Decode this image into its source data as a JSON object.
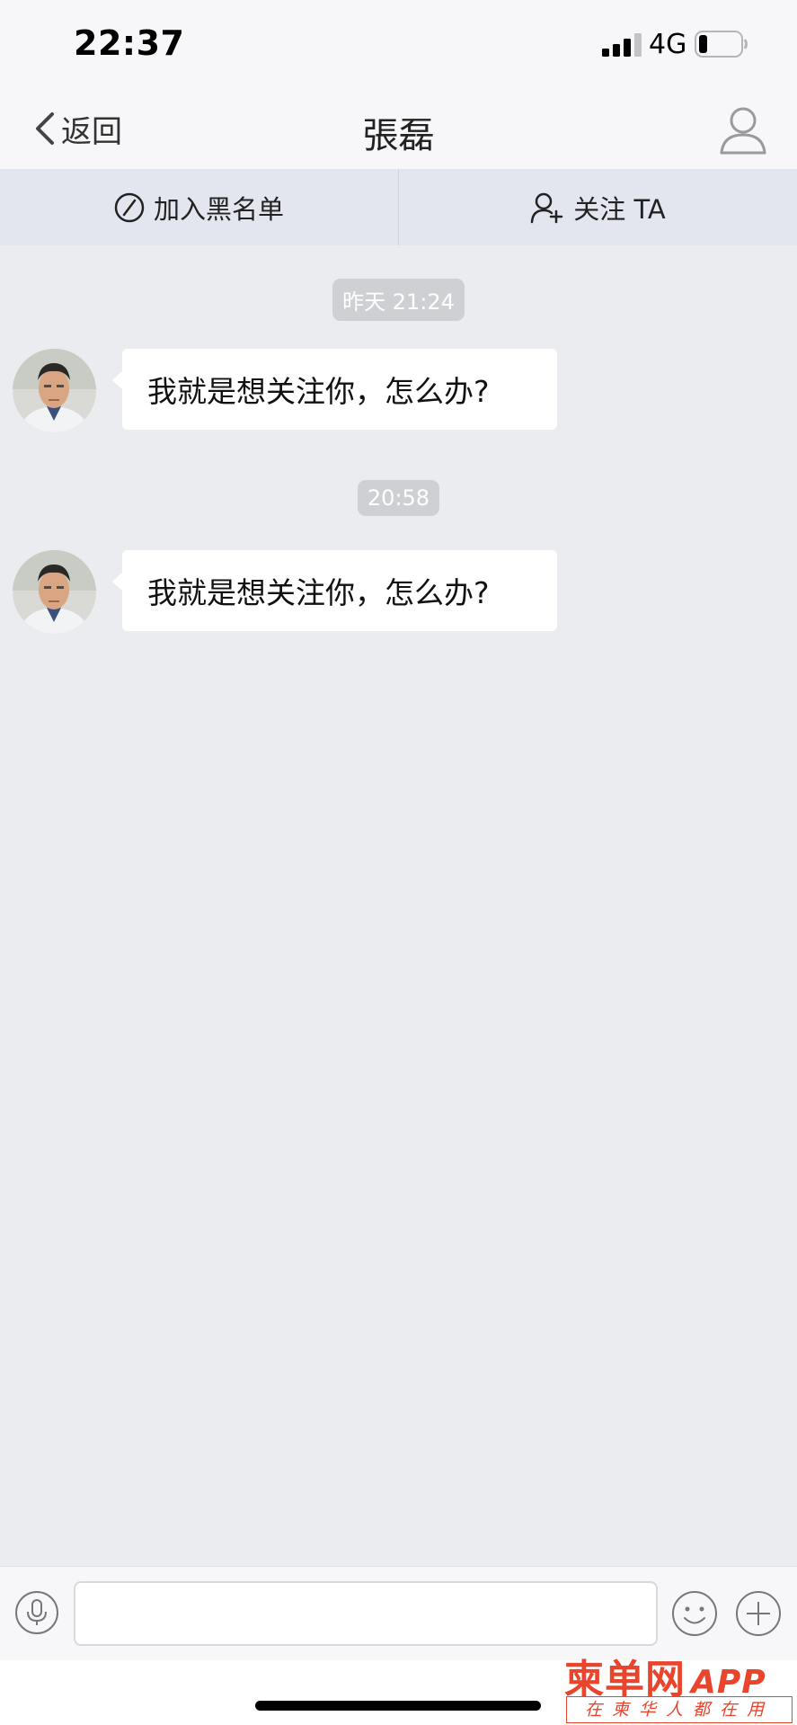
{
  "status_bar": {
    "time": "22:37",
    "network": "4G",
    "signal_bars": 3,
    "battery_icon": "battery-low-icon"
  },
  "nav": {
    "back_label": "返回",
    "title": "張磊",
    "profile_icon": "person-icon"
  },
  "actions": {
    "blacklist_label": "加入黑名单",
    "follow_label": "关注 TA"
  },
  "conversation": {
    "messages": [
      {
        "timestamp": "昨天 21:24",
        "text": "我就是想关注你，怎么办?"
      },
      {
        "timestamp": "20:58",
        "text": "我就是想关注你，怎么办?"
      }
    ]
  },
  "input_bar": {
    "value": "",
    "placeholder": ""
  },
  "watermark": {
    "main": "柬单网",
    "app": "APP",
    "tagline": "在柬华人都在用"
  },
  "colors": {
    "background": "#ebecf0",
    "action_bar": "#e3e6ef",
    "timestamp_bg": "#cfd0d3",
    "bubble": "#ffffff",
    "watermark": "#e8452c"
  }
}
